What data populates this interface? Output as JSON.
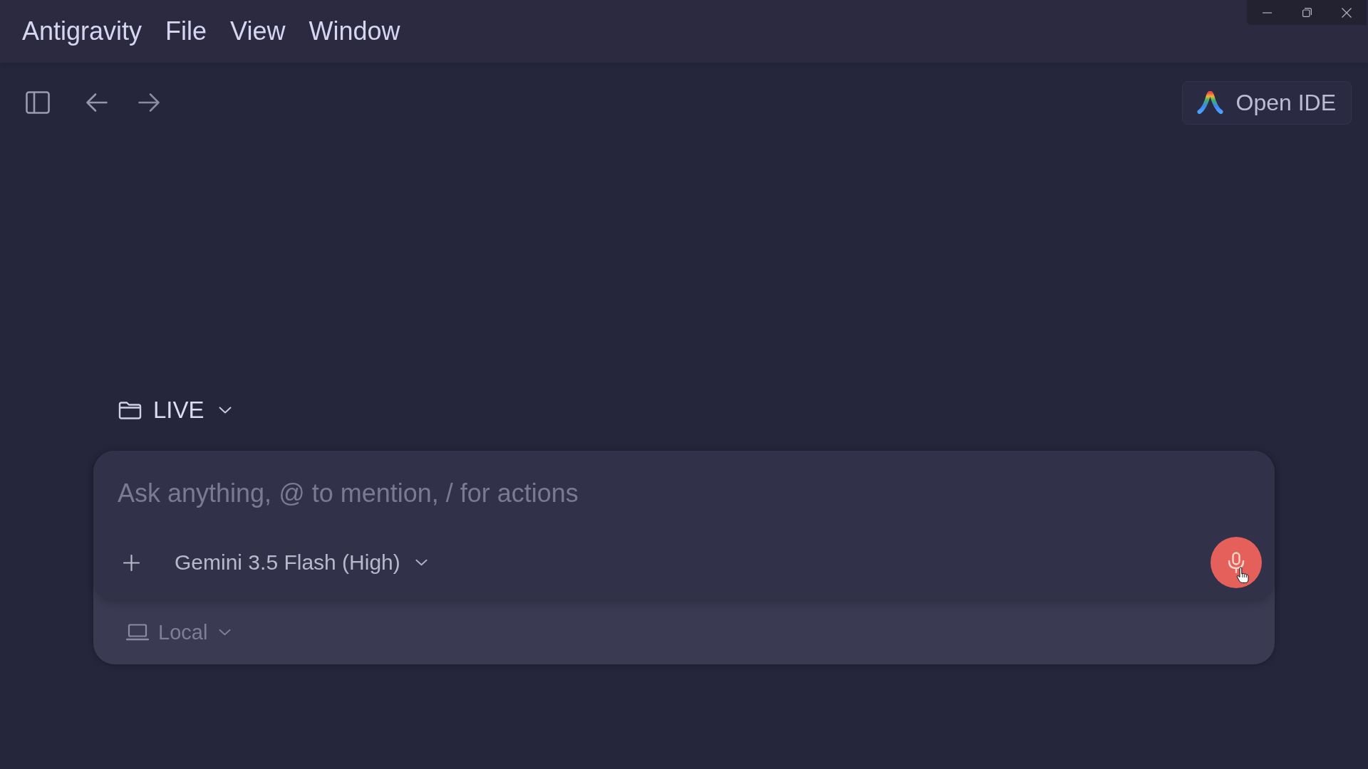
{
  "menu_bar": {
    "items": [
      {
        "label": "Antigravity"
      },
      {
        "label": "File"
      },
      {
        "label": "View"
      },
      {
        "label": "Window"
      }
    ]
  },
  "toolbar": {
    "open_ide_button": {
      "label": "Open IDE"
    }
  },
  "workspace_selector": {
    "label": "LIVE"
  },
  "prompt_box": {
    "placeholder": "Ask anything, @ to mention, / for actions",
    "model_selector": {
      "label": "Gemini 3.5 Flash (High)"
    },
    "environment_selector": {
      "label": "Local"
    }
  }
}
